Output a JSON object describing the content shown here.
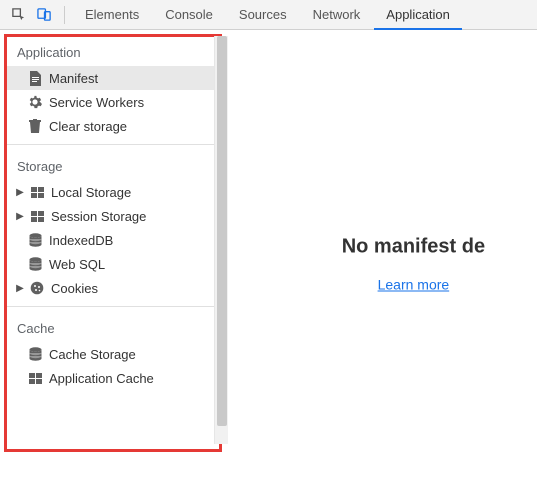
{
  "tabs": {
    "elements": "Elements",
    "console": "Console",
    "sources": "Sources",
    "network": "Network",
    "application": "Application"
  },
  "sidebar": {
    "section_application": "Application",
    "manifest": "Manifest",
    "service_workers": "Service Workers",
    "clear_storage": "Clear storage",
    "section_storage": "Storage",
    "local_storage": "Local Storage",
    "session_storage": "Session Storage",
    "indexeddb": "IndexedDB",
    "web_sql": "Web SQL",
    "cookies": "Cookies",
    "section_cache": "Cache",
    "cache_storage": "Cache Storage",
    "application_cache": "Application Cache"
  },
  "content": {
    "empty_heading": "No manifest de",
    "learn_more": "Learn more"
  }
}
